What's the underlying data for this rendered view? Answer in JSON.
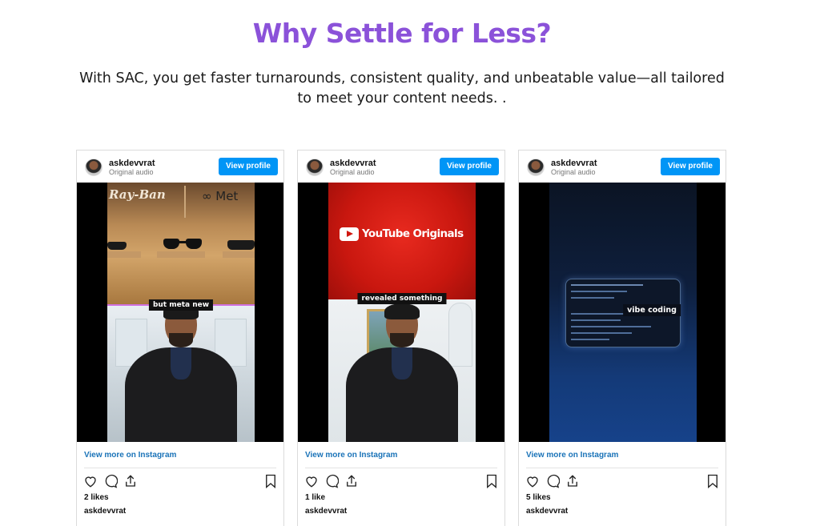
{
  "section": {
    "title": "Why Settle for Less?",
    "subtitle": "With SAC, you get faster turnarounds, consistent quality, and unbeatable value—all tailored to meet your content needs. ."
  },
  "colors": {
    "accent": "#8b52d9",
    "button": "#0095f6",
    "link": "#1a73b8"
  },
  "posts": [
    {
      "username": "askdevvrat",
      "audio": "Original audio",
      "view_profile": "View profile",
      "overlay_texts": [
        "Ray-Ban",
        "∞ Met"
      ],
      "caption": "but meta new",
      "view_more": "View more on Instagram",
      "likes": "2 likes",
      "owner": "askdevvrat"
    },
    {
      "username": "askdevvrat",
      "audio": "Original audio",
      "view_profile": "View profile",
      "overlay_texts": [
        "YouTube Originals"
      ],
      "caption": "revealed something",
      "view_more": "View more on Instagram",
      "likes": "1 like",
      "owner": "askdevvrat"
    },
    {
      "username": "askdevvrat",
      "audio": "Original audio",
      "view_profile": "View profile",
      "overlay_texts": [],
      "caption": "vibe coding",
      "view_more": "View more on Instagram",
      "likes": "5 likes",
      "owner": "askdevvrat"
    }
  ],
  "icons": [
    "heart-icon",
    "comment-icon",
    "share-icon",
    "bookmark-icon"
  ]
}
